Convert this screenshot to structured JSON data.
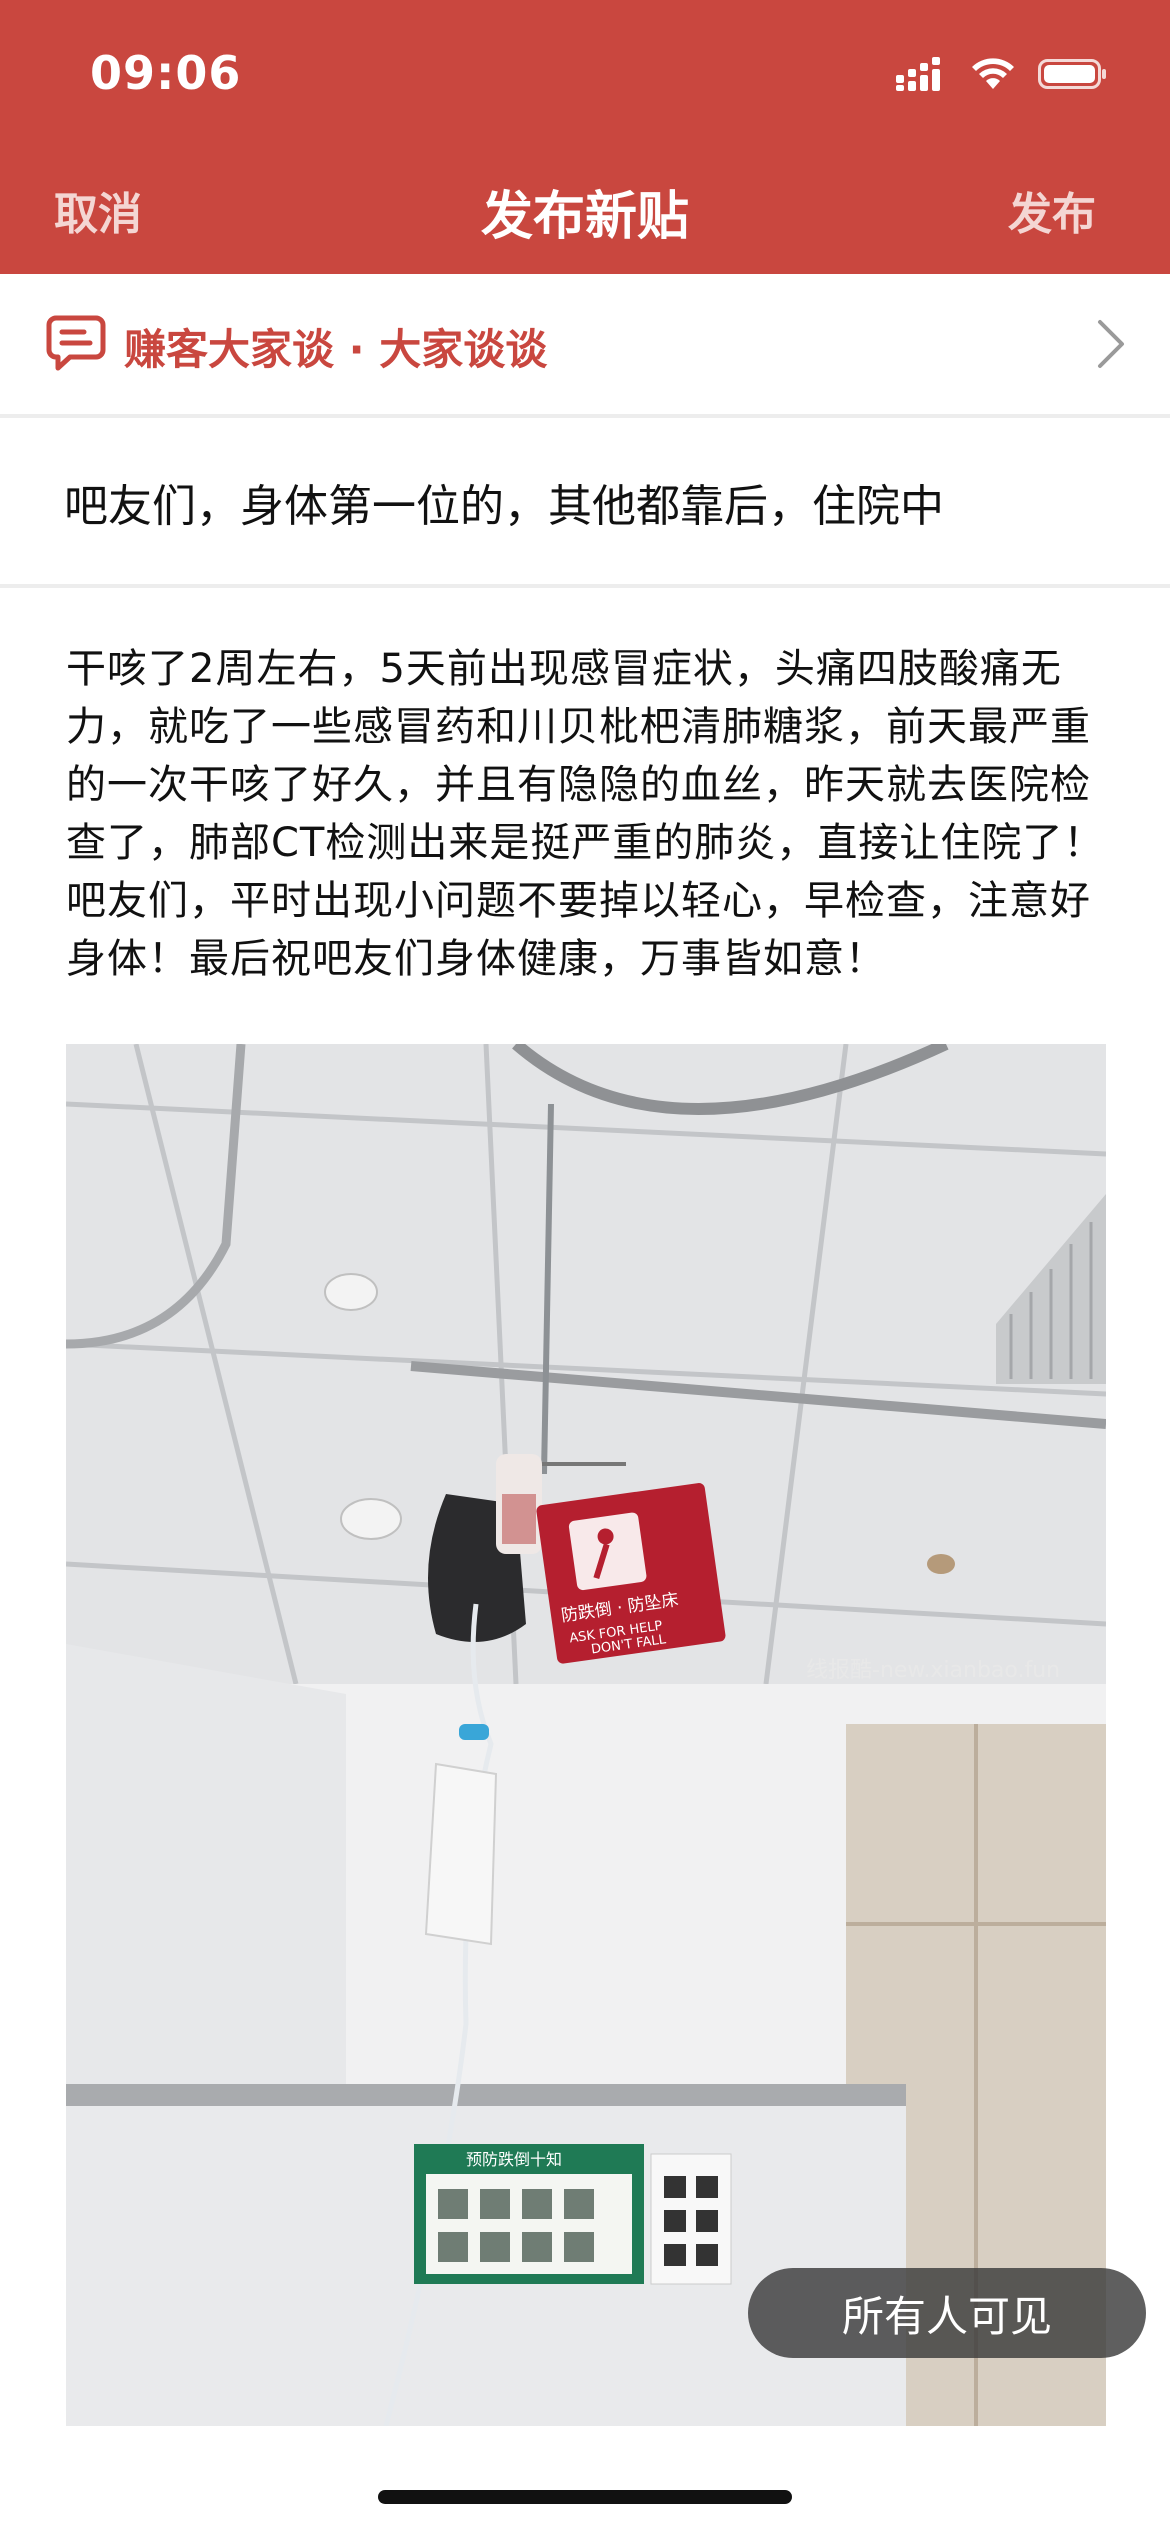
{
  "status_bar": {
    "time": "09:06"
  },
  "nav": {
    "cancel_label": "取消",
    "title": "发布新贴",
    "publish_label": "发布"
  },
  "forum": {
    "label": "赚客大家谈 · 大家谈谈",
    "icon": "chat-bubble-icon"
  },
  "post": {
    "title": "吧友们，身体第一位的，其他都靠后，住院中",
    "body": "干咳了2周左右，5天前出现感冒症状，头痛四肢酸痛无力，就吃了一些感冒药和川贝枇杷清肺糖浆，前天最严重的一次干咳了好久，并且有隐隐的血丝，昨天就去医院检查了，肺部CT检测出来是挺严重的肺炎，直接让住院了！吧友们，平时出现小问题不要掉以轻心，早检查，注意好身体！最后祝吧友们身体健康，万事皆如意！"
  },
  "photo": {
    "watermark": "线报酷-new.xianbao.fun",
    "sign_line1": "防跌倒 · 防坠床",
    "sign_line2": "ASK FOR HELP",
    "sign_line3": "DON'T FALL",
    "poster_title": "预防跌倒十知"
  },
  "visibility": {
    "label": "所有人可见"
  },
  "colors": {
    "brand": "#c9473f",
    "divider": "#ededed"
  }
}
